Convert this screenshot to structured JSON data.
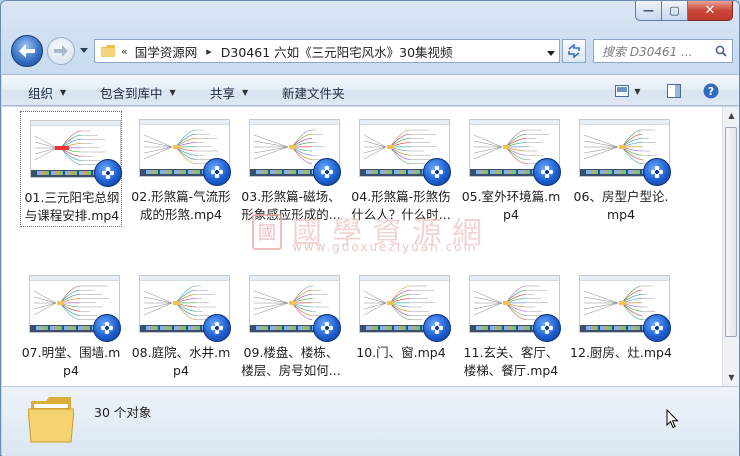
{
  "window": {
    "controls": {
      "minimize": "—",
      "maximize": "▢",
      "close": "✕"
    }
  },
  "nav": {
    "breadcrumb_root_sep": "«",
    "breadcrumbs": [
      "国学资源网",
      "D30461 六如《三元阳宅风水》30集视频"
    ],
    "crumb_sep": "▸",
    "search_placeholder": "搜索 D30461 ..."
  },
  "toolbar": {
    "organize": "组织",
    "include_library": "包含到库中",
    "share": "共享",
    "new_folder": "新建文件夹"
  },
  "files": [
    {
      "name": "01.三元阳宅总纲与课程安排.mp4",
      "selected": true
    },
    {
      "name": "02.形煞篇-气流形成的形煞.mp4",
      "selected": false
    },
    {
      "name": "03.形煞篇-磁场、形象感应形成的...",
      "selected": false
    },
    {
      "name": "04.形煞篇-形煞伤什么人？什么时...",
      "selected": false
    },
    {
      "name": "05.室外环境篇.mp4",
      "selected": false
    },
    {
      "name": "06、房型户型论.mp4",
      "selected": false
    },
    {
      "name": "07.明堂、围墙.mp4",
      "selected": false
    },
    {
      "name": "08.庭院、水井.mp4",
      "selected": false
    },
    {
      "name": "09.楼盘、楼栋、楼层、房号如何...",
      "selected": false
    },
    {
      "name": "10.门、窗.mp4",
      "selected": false
    },
    {
      "name": "11.玄关、客厅、楼梯、餐厅.mp4",
      "selected": false
    },
    {
      "name": "12.厨房、灶.mp4",
      "selected": false
    }
  ],
  "watermark": {
    "text": "國學資源網",
    "url": "www.guoxueziyuan.com",
    "seal": "國"
  },
  "status": {
    "count": "30 个对象"
  },
  "colors": {
    "accent": "#2f6bbf",
    "close": "#c0392b",
    "window_bg": "#c9dcf0"
  }
}
